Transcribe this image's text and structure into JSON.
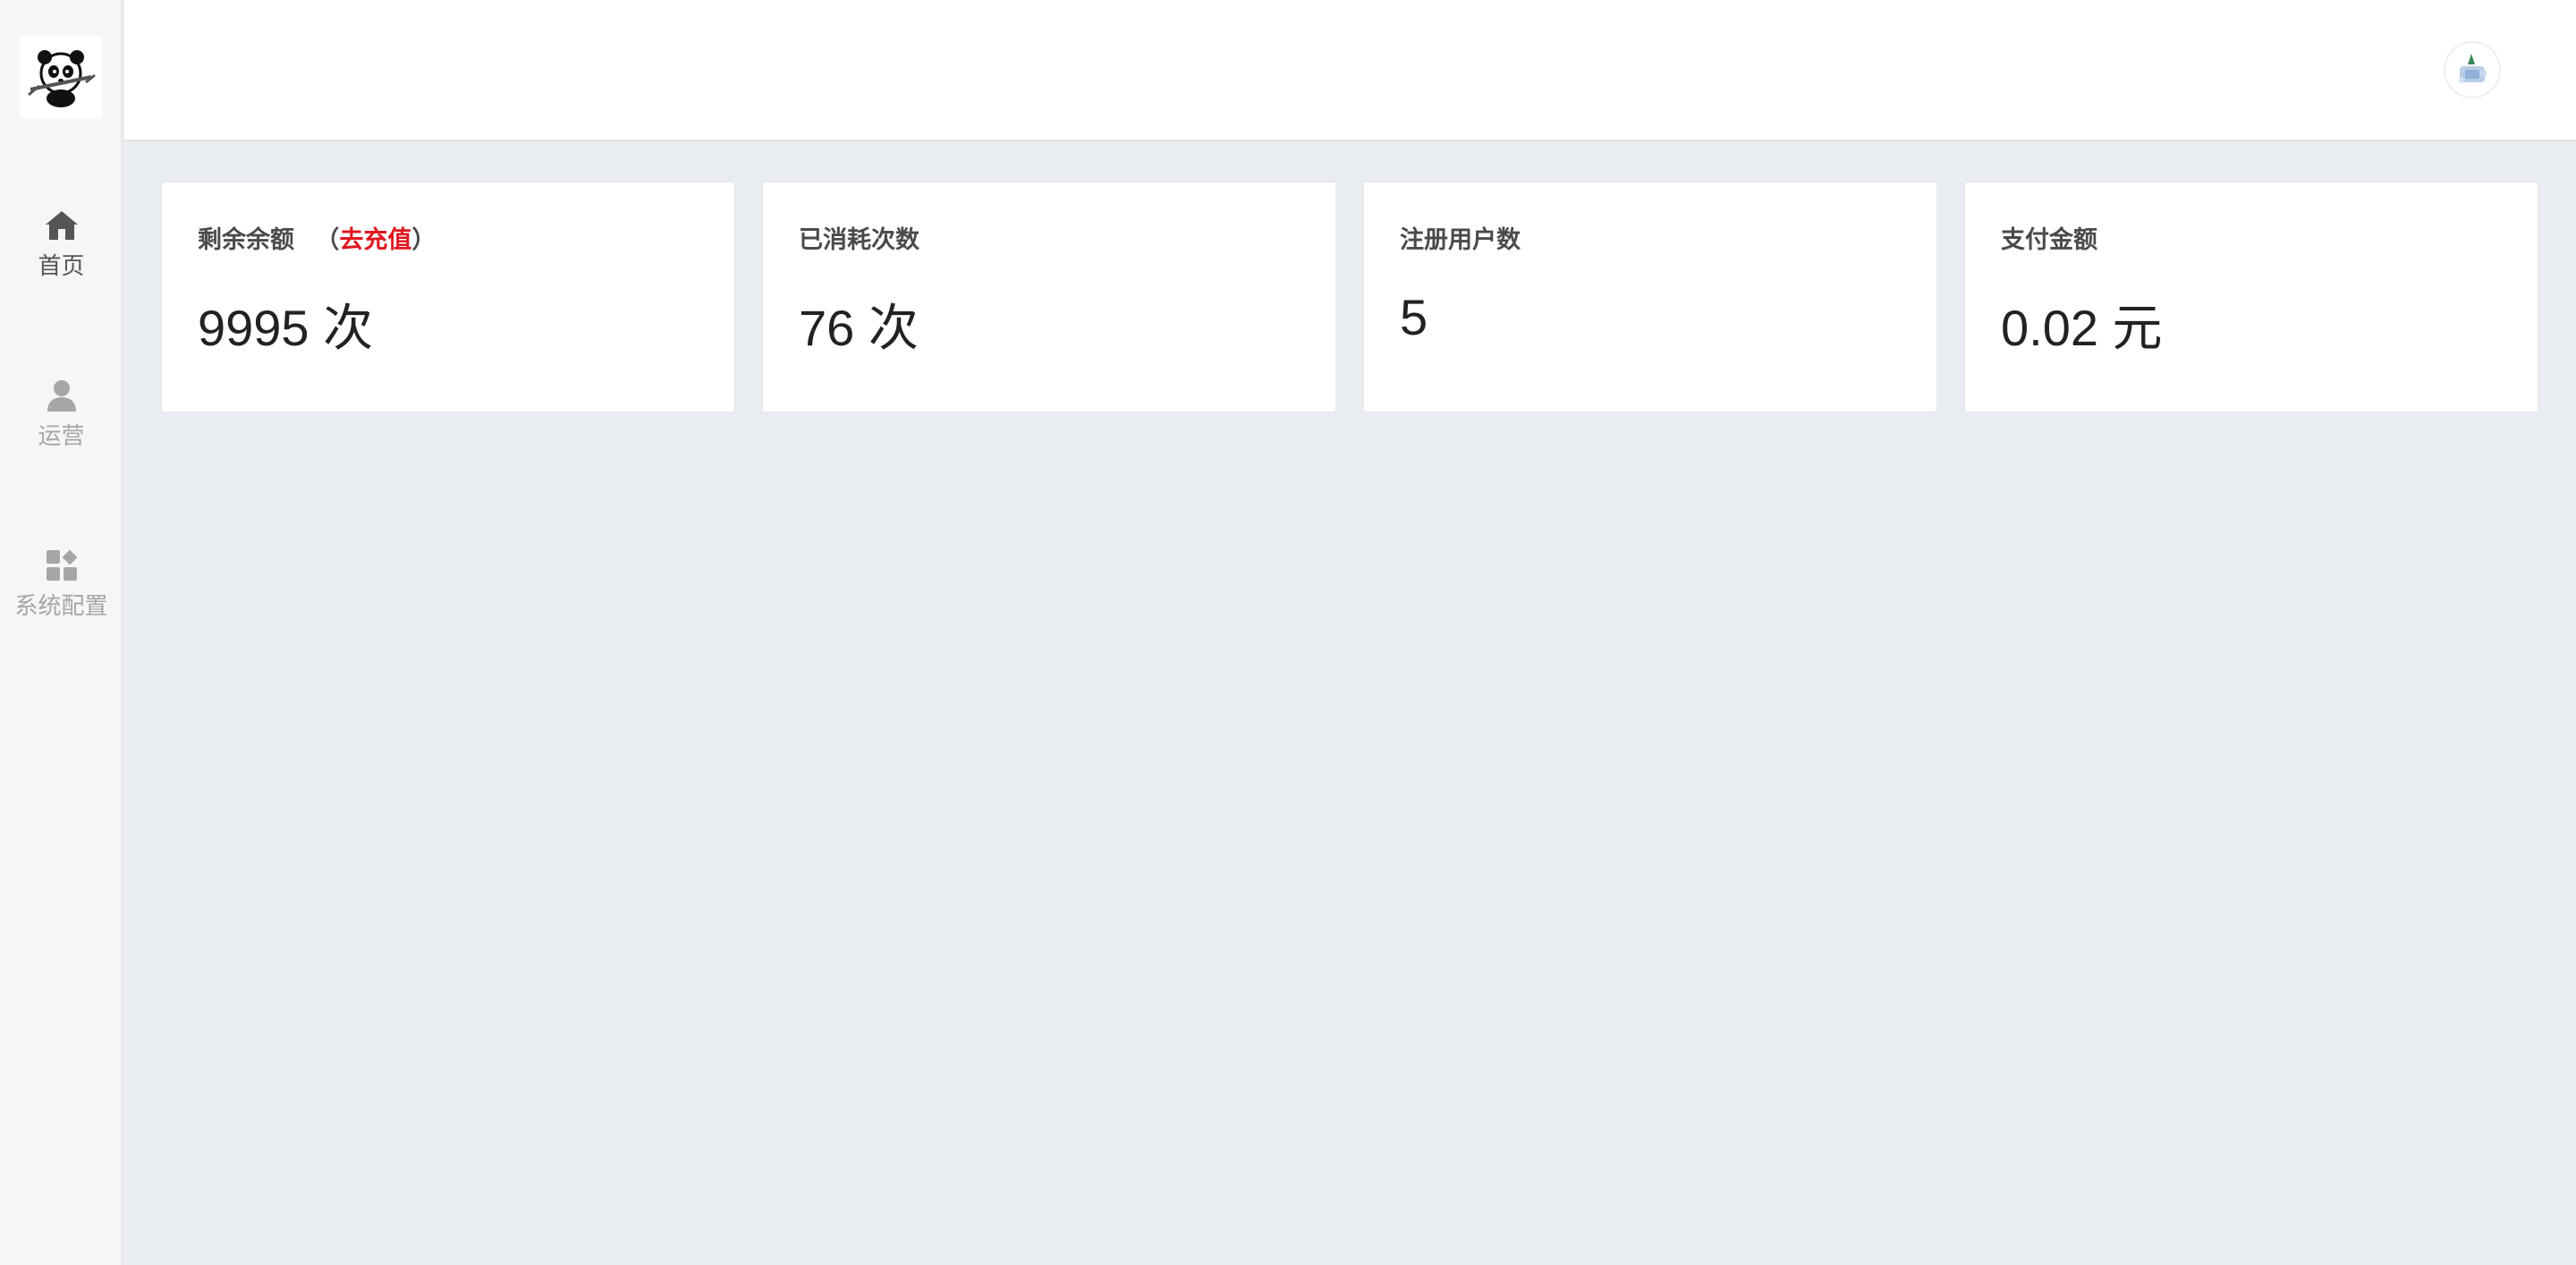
{
  "sidebar": {
    "items": [
      {
        "label": "首页",
        "icon": "home-icon",
        "active": true
      },
      {
        "label": "运营",
        "icon": "user-icon",
        "active": false
      },
      {
        "label": "系统配置",
        "icon": "grid-icon",
        "active": false
      }
    ]
  },
  "stats": [
    {
      "title": "剩余余额",
      "paren_open": "（",
      "link": "去充值",
      "paren_close": "）",
      "value": "9995 次"
    },
    {
      "title": "已消耗次数",
      "value": "76 次"
    },
    {
      "title": "注册用户数",
      "value": "5"
    },
    {
      "title": "支付金额",
      "value": "0.02 元"
    }
  ],
  "colors": {
    "accent_link": "#e0161f",
    "sidebar_bg": "#f6f6f6",
    "page_bg": "#e9edf2"
  }
}
